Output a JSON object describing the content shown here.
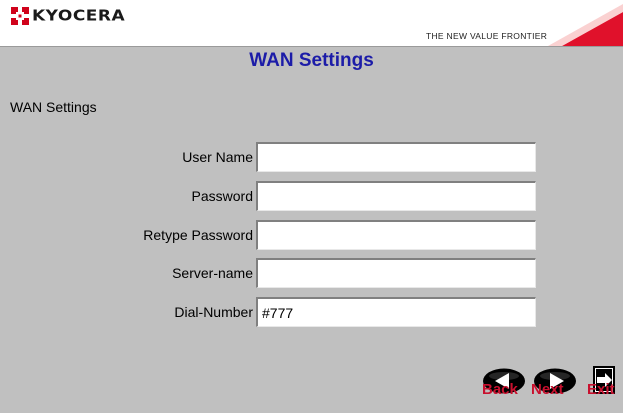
{
  "header": {
    "brand": "KYOCERA",
    "tagline": "THE NEW VALUE FRONTIER"
  },
  "page": {
    "title": "WAN Settings",
    "section_label": "WAN Settings"
  },
  "form": {
    "user_name_label": "User Name",
    "user_name_value": "",
    "password_label": "Password",
    "password_value": "",
    "retype_password_label": "Retype Password",
    "retype_password_value": "",
    "server_name_label": "Server-name",
    "server_name_value": "",
    "dial_number_label": "Dial-Number",
    "dial_number_value": "#777"
  },
  "nav": {
    "back_label": "Back",
    "next_label": "Next",
    "exit_label": "Exit"
  },
  "colors": {
    "background": "#c0c0c0",
    "title": "#1c1ca8",
    "accent_red": "#c8102e"
  }
}
